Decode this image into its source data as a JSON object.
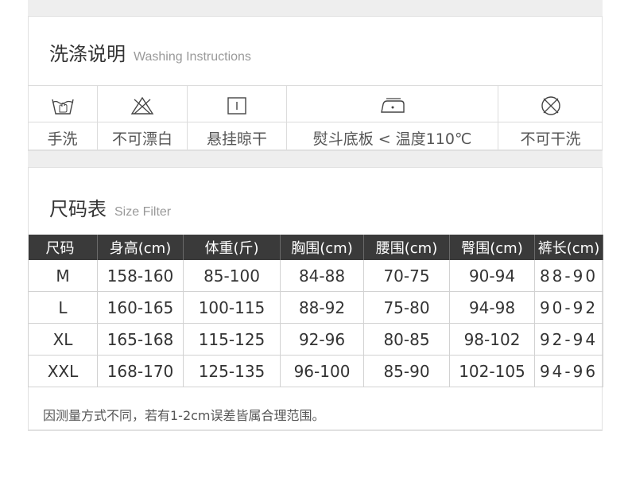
{
  "colors": {
    "header_bg": "#3a3a3a",
    "band": "#eeeeee",
    "text": "#333333"
  },
  "washing": {
    "title_cn": "洗涤说明",
    "title_en": "Washing Instructions",
    "items": [
      {
        "icon": "hand-wash-icon",
        "label": "手洗"
      },
      {
        "icon": "no-bleach-icon",
        "label": "不可漂白"
      },
      {
        "icon": "hang-dry-icon",
        "label": "悬挂晾干"
      },
      {
        "icon": "iron-icon",
        "label": "熨斗底板 < 温度110℃"
      },
      {
        "icon": "no-dry-clean-icon",
        "label": "不可干洗"
      }
    ]
  },
  "size": {
    "title_cn": "尺码表",
    "title_en": "Size Filter",
    "headers": [
      "尺码",
      "身高(cm)",
      "体重(斤)",
      "胸围(cm)",
      "腰围(cm)",
      "臀围(cm)",
      "裤长(cm)"
    ],
    "rows": [
      [
        "M",
        "158-160",
        "85-100",
        "84-88",
        "70-75",
        "90-94",
        "88-90"
      ],
      [
        "L",
        "160-165",
        "100-115",
        "88-92",
        "75-80",
        "94-98",
        "90-92"
      ],
      [
        "XL",
        "165-168",
        "115-125",
        "92-96",
        "80-85",
        "98-102",
        "92-94"
      ],
      [
        "XXL",
        "168-170",
        "125-135",
        "96-100",
        "85-90",
        "102-105",
        "94-96"
      ]
    ],
    "note": "因测量方式不同，若有1-2cm误差皆属合理范围。"
  }
}
